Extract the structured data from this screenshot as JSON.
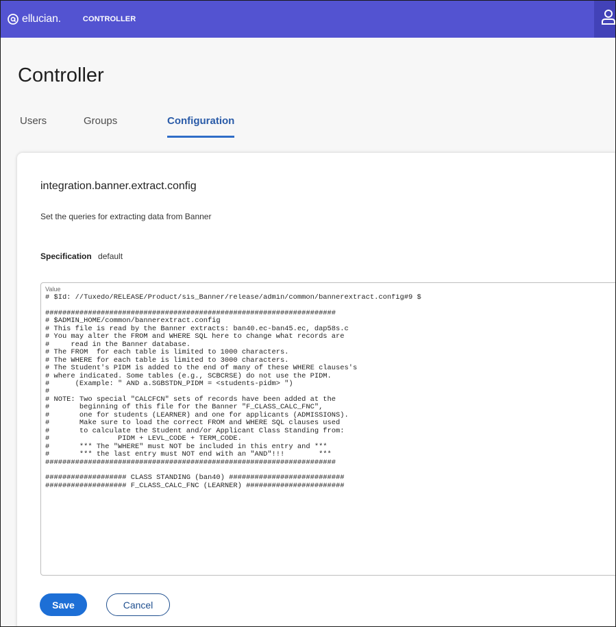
{
  "header": {
    "brand_name": "ellucian.",
    "product_name": "CONTROLLER",
    "brand_icon": "ellucian-logo-icon",
    "user_icon": "user-icon",
    "colors": {
      "header_bg": "#5353d1",
      "accent": "#2f6dc7",
      "primary_button": "#1d6fd6"
    }
  },
  "page": {
    "title": "Controller"
  },
  "tabs": [
    {
      "label": "Users",
      "active": false
    },
    {
      "label": "Groups",
      "active": false
    },
    {
      "label": "Configuration",
      "active": true
    }
  ],
  "config": {
    "name": "integration.banner.extract.config",
    "description": "Set the queries for extracting data from Banner",
    "specification_label": "Specification",
    "specification_value": "default",
    "value_label": "Value",
    "value_text": "# $Id: //Tuxedo/RELEASE/Product/sis_Banner/release/admin/common/bannerextract.config#9 $\n\n####################################################################\n# $ADMIN_HOME/common/bannerextract.config\n# This file is read by the Banner extracts: ban40.ec-ban45.ec, dap58s.c\n# You may alter the FROM and WHERE SQL here to change what records are\n#     read in the Banner database.\n# The FROM  for each table is limited to 1000 characters.\n# The WHERE for each table is limited to 3000 characters.\n# The Student's PIDM is added to the end of many of these WHERE clauses's\n# where indicated. Some tables (e.g., SCBCRSE) do not use the PIDM.\n#      (Example: \" AND a.SGBSTDN_PIDM = <students-pidm> \")\n#\n# NOTE: Two special \"CALCFCN\" sets of records have been added at the\n#       beginning of this file for the Banner \"F_CLASS_CALC_FNC\",\n#       one for students (LEARNER) and one for applicants (ADMISSIONS).\n#       Make sure to load the correct FROM and WHERE SQL clauses used\n#       to calculate the Student and/or Applicant Class Standing from:\n#                PIDM + LEVL_CODE + TERM_CODE.\n#       *** The \"WHERE\" must NOT be included in this entry and ***\n#       *** the last entry must NOT end with an \"AND\"!!!        ***\n####################################################################\n\n################### CLASS STANDING (ban40) ###########################\n################### F_CLASS_CALC_FNC (LEARNER) #######################"
  },
  "actions": {
    "save_label": "Save",
    "cancel_label": "Cancel"
  }
}
